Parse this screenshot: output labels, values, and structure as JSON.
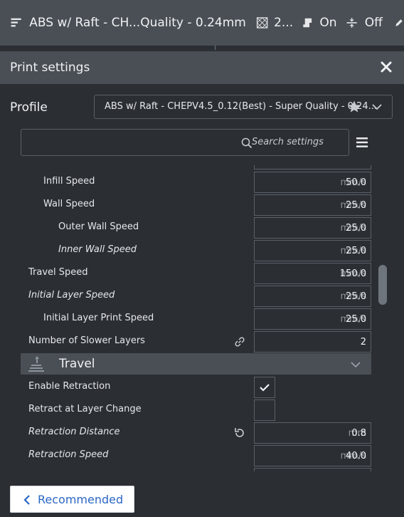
{
  "topbar": {
    "profile_summary": "ABS w/ Raft - CH...Quality - 0.24mm",
    "infill_value": "2...",
    "support_value": "On",
    "adhesion_value": "Off"
  },
  "panel": {
    "title": "Print settings",
    "profile_label": "Profile",
    "profile_value": "ABS w/ Raft - CHEPV4.5_0.12(Best) - Super Quality - 0.24...",
    "search_placeholder": "Search settings"
  },
  "settings": [
    {
      "label": "Infill Speed",
      "unit": "mm/s",
      "value": "50.0"
    },
    {
      "label": "Wall Speed",
      "unit": "mm/s",
      "value": "25.0"
    },
    {
      "label": "Outer Wall Speed",
      "unit": "mm/s",
      "value": "25.0"
    },
    {
      "label": "Inner Wall Speed",
      "unit": "mm/s",
      "value": "25.0"
    },
    {
      "label": "Travel Speed",
      "unit": "mm/s",
      "value": "150.0"
    },
    {
      "label": "Initial Layer Speed",
      "unit": "mm/s",
      "value": "25.0"
    },
    {
      "label": "Initial Layer Print Speed",
      "unit": "mm/s",
      "value": "25.0"
    },
    {
      "label": "Number of Slower Layers",
      "value": "2"
    }
  ],
  "travel_category": {
    "title": "Travel",
    "enable_retraction_label": "Enable Retraction",
    "enable_retraction_checked": true,
    "retract_layer_change_label": "Retract at Layer Change",
    "retract_layer_change_checked": false,
    "retraction_distance_label": "Retraction Distance",
    "retraction_distance_unit": "mm",
    "retraction_distance_value": "0.8",
    "retraction_speed_label": "Retraction Speed",
    "retraction_speed_unit": "mm/s",
    "retraction_speed_value": "40.0"
  },
  "bottom": {
    "recommended_label": "Recommended"
  },
  "icons": {
    "profile": "profile-icon",
    "infill": "infill-icon",
    "support": "support-icon",
    "adhesion": "adhesion-icon",
    "edit": "pencil-icon",
    "close": "close-icon",
    "star": "star-icon",
    "chevron": "chevron-down-icon",
    "search": "search-icon",
    "menu": "menu-icon",
    "link": "link-icon",
    "reset": "reset-icon",
    "travel": "travel-icon",
    "back": "chevron-left-icon"
  },
  "colors": {
    "background": "#2b2f34",
    "header": "#4a4f55",
    "accent": "#2a67c5"
  }
}
